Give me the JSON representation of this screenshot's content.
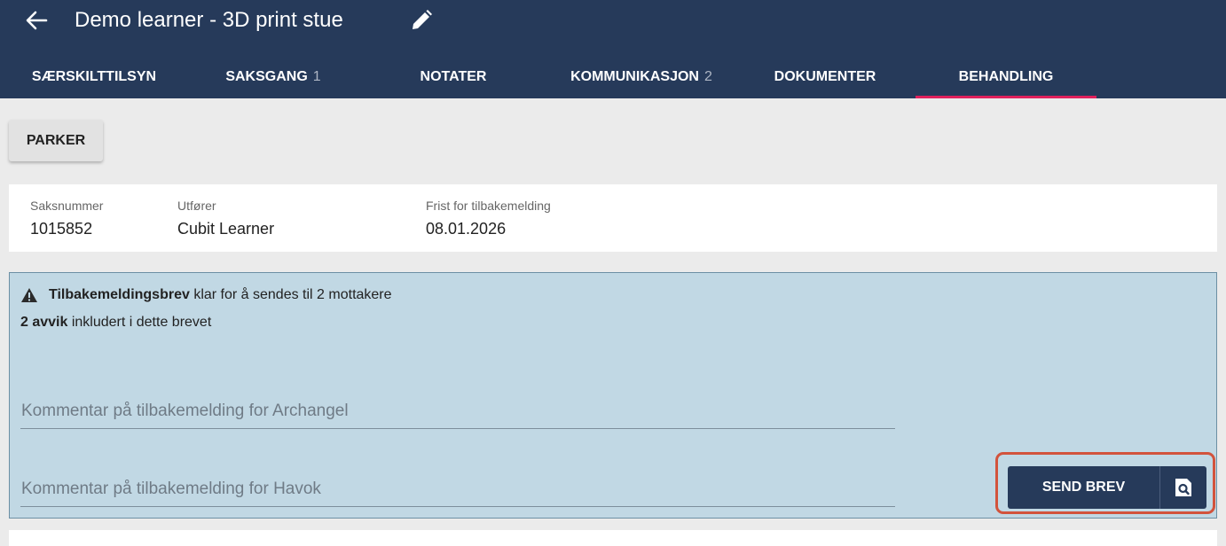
{
  "header": {
    "title": "Demo learner - 3D print stue",
    "back_icon": "arrow-left-icon",
    "edit_icon": "pencil-icon",
    "background": "#263a5a"
  },
  "tabs": [
    {
      "label": "SÆRSKILTTILSYN",
      "count": "",
      "active": false
    },
    {
      "label": "SAKSGANG",
      "count": "1",
      "active": false
    },
    {
      "label": "NOTATER",
      "count": "",
      "active": false
    },
    {
      "label": "KOMMUNIKASJON",
      "count": "2",
      "active": false
    },
    {
      "label": "DOKUMENTER",
      "count": "",
      "active": false
    },
    {
      "label": "BEHANDLING",
      "count": "",
      "active": true
    }
  ],
  "toolbar": {
    "park_label": "PARKER"
  },
  "info": {
    "case_number": {
      "label": "Saksnummer",
      "value": "1015852"
    },
    "performer": {
      "label": "Utfører",
      "value": "Cubit Learner"
    },
    "deadline": {
      "label": "Frist for tilbakemelding",
      "value": "08.01.2026"
    }
  },
  "panel": {
    "alert_bold": "Tilbakemeldingsbrev",
    "alert_rest": " klar for å sendes til 2 mottakere",
    "alert_icon": "warning-icon",
    "avvik_bold": "2 avvik",
    "avvik_rest": " inkludert i dette brevet",
    "comments": [
      {
        "placeholder": "Kommentar på tilbakemelding for Archangel",
        "value": ""
      },
      {
        "placeholder": "Kommentar på tilbakemelding for Havok",
        "value": ""
      }
    ],
    "send_label": "SEND BREV",
    "preview_icon": "document-search-icon",
    "background": "#c1d8e4"
  },
  "colors": {
    "accent": "#e0205c",
    "highlight": "#d2533c"
  }
}
